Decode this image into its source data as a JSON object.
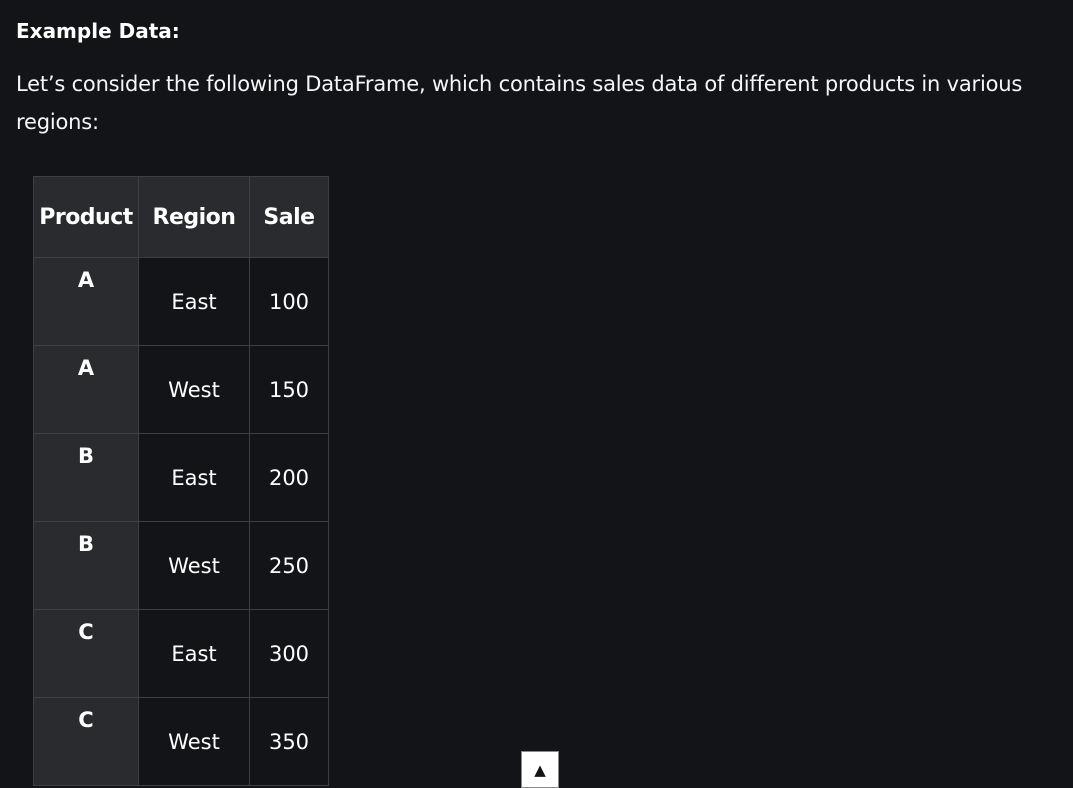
{
  "article": {
    "heading": "Example Data:",
    "intro": "Let’s consider the following DataFrame, which contains sales data of different products in various regions:"
  },
  "table": {
    "headers": [
      "Product",
      "Region",
      "Sale"
    ],
    "rows": [
      {
        "product": "A",
        "region": "East",
        "sale": "100"
      },
      {
        "product": "A",
        "region": "West",
        "sale": "150"
      },
      {
        "product": "B",
        "region": "East",
        "sale": "200"
      },
      {
        "product": "B",
        "region": "West",
        "sale": "250"
      },
      {
        "product": "C",
        "region": "East",
        "sale": "300"
      },
      {
        "product": "C",
        "region": "West",
        "sale": "350"
      }
    ]
  },
  "scroll_top": {
    "icon": "arrow-up-icon",
    "glyph": "▲"
  },
  "colors": {
    "background": "#131417",
    "header_cell": "#2a2b2e",
    "border": "#3e3f43",
    "text": "#ffffff"
  }
}
